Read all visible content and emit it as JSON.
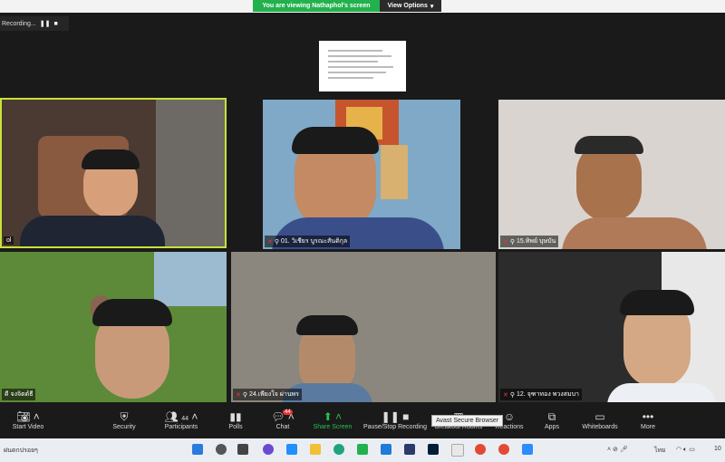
{
  "banner": {
    "viewing": "You are viewing Nathaphol's screen",
    "options": "View Options"
  },
  "recording": {
    "label": "Recording..."
  },
  "tiles": [
    {
      "name": "ol"
    },
    {
      "name": "01. วิเชียร บูรณะสันติกุล"
    },
    {
      "name": "15.ทิพย์ บุษบัน"
    },
    {
      "name": "ดี จงจิตต์ธี"
    },
    {
      "name": "24.เพียงใจ ผ่านพร"
    },
    {
      "name": "12. จุฑาทอง พวงสมบา"
    }
  ],
  "toolbar": {
    "start_video": "Start Video",
    "security": "Security",
    "participants": "Participants",
    "participants_count": "44",
    "polls": "Polls",
    "chat": "Chat",
    "chat_badge": "44",
    "share_screen": "Share Screen",
    "pause_stop": "Pause/Stop Recording",
    "breakout": "Breakout Rooms",
    "reactions": "Reactions",
    "apps": "Apps",
    "whiteboards": "Whiteboards",
    "more": "More"
  },
  "tooltip": "Avast Secure Browser",
  "taskbar": {
    "weather": "ฝนตกปรอยๆ",
    "lang": "ไทย",
    "clock": "10"
  }
}
